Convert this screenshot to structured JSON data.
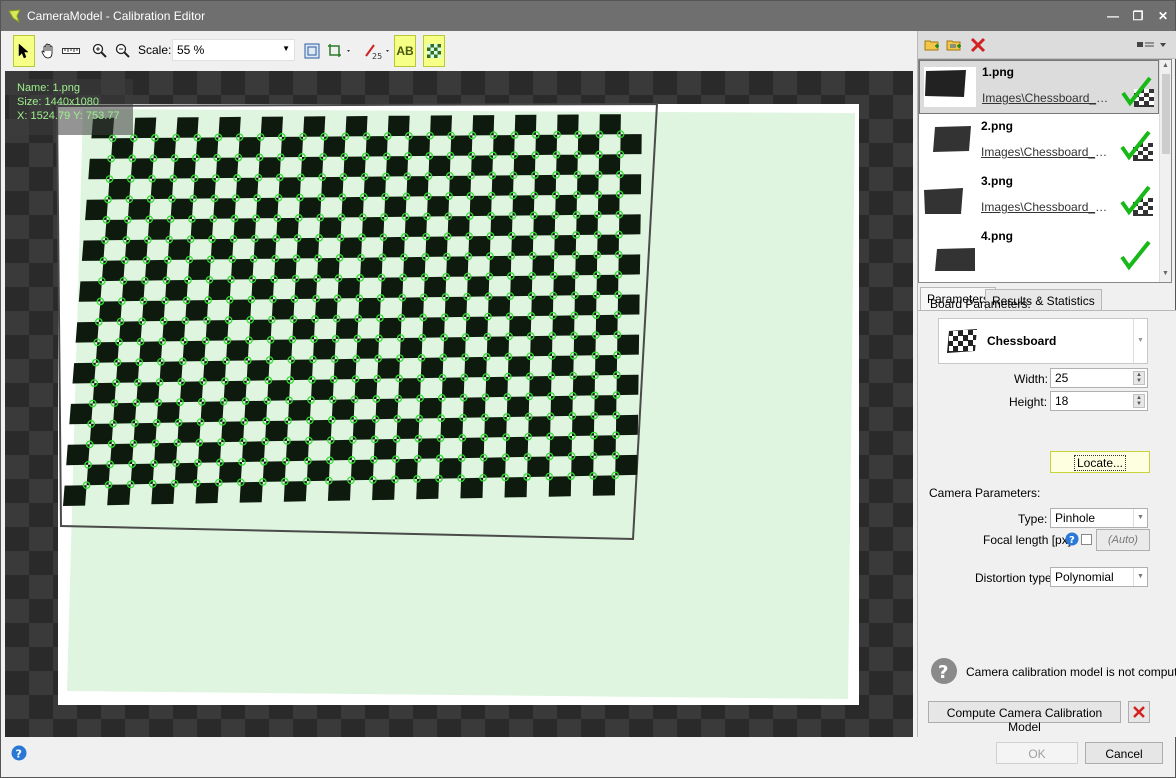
{
  "window": {
    "title": "CameraModel - Calibration Editor",
    "controls": [
      "minimize-icon",
      "maximize-icon",
      "close-icon"
    ]
  },
  "toolbar": {
    "scale_label": "Scale:",
    "scale_value": "55 %",
    "ab_label": "AB",
    "tools": [
      "select-arrow-icon",
      "hand-pan-icon",
      "ruler-icon",
      "zoom-in-icon",
      "zoom-out-icon",
      "fit-to-window-icon",
      "crop-icon",
      "marker-icon",
      "text-overlay-icon",
      "chessboard-overlay-icon"
    ]
  },
  "info": {
    "name": "Name: 1.png",
    "size": "Size: 1440x1080",
    "coords": "X: 1524.79 Y: 753.77"
  },
  "images": [
    {
      "name": "1.png",
      "path": "Images\\Chessboard_Cali...",
      "selected": true
    },
    {
      "name": "2.png",
      "path": "Images\\Chessboard_Cali...",
      "selected": false
    },
    {
      "name": "3.png",
      "path": "Images\\Chessboard_Cali...",
      "selected": false
    },
    {
      "name": "4.png",
      "path": "",
      "selected": false
    }
  ],
  "tabs": {
    "parameters": "Parameters",
    "results": "Results & Statistics"
  },
  "board": {
    "section_label": "Board Parameters:",
    "type": "Chessboard",
    "width_label": "Width:",
    "width_value": "25",
    "height_label": "Height:",
    "height_value": "18",
    "locate_button": "Locate..."
  },
  "camera": {
    "section_label": "Camera Parameters:",
    "type_label": "Type:",
    "type_value": "Pinhole",
    "focal_label": "Focal length [px]:",
    "focal_value": "(Auto)",
    "distortion_label": "Distortion type:",
    "distortion_value": "Polynomial"
  },
  "status": {
    "message": "Camera calibration model is not computed."
  },
  "compute_button": "Compute Camera Calibration Model",
  "footer": {
    "ok": "OK",
    "cancel": "Cancel"
  },
  "colors": {
    "titlebar": "#6f6f6f",
    "accent_yellow": "#f6ff86",
    "corner_green": "#33dd33",
    "info_text": "#9ef08e",
    "canvas_bg": "#3a3a3a"
  }
}
